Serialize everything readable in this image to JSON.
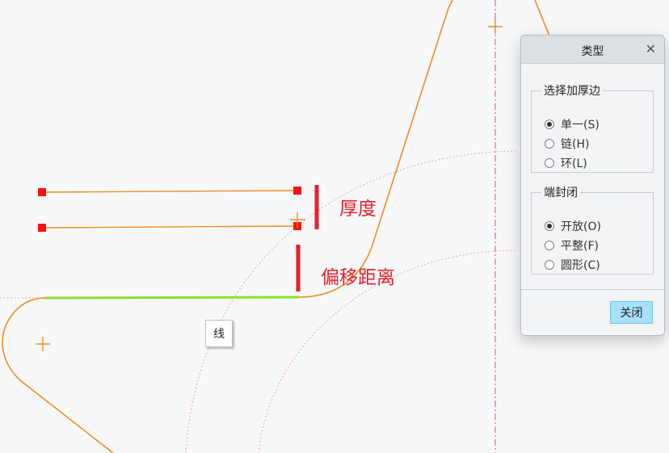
{
  "canvas": {
    "annotations": {
      "thickness": "厚度",
      "offset_distance": "偏移距离"
    },
    "tooltip": "线",
    "colors": {
      "curve": "#f28c1f",
      "selected_edge": "#8fe02a",
      "handle": "#ff1010",
      "annotation": "#e8202a",
      "dotted_guide": "#e98aa6",
      "centerline": "#ff5a9a"
    }
  },
  "dialog": {
    "title": "类型",
    "close_icon": "close-icon",
    "group_thicken_edge": {
      "label": "选择加厚边",
      "options": [
        {
          "label": "单一(S)",
          "checked": true
        },
        {
          "label": "链(H)",
          "checked": false
        },
        {
          "label": "环(L)",
          "checked": false
        }
      ]
    },
    "group_end_cap": {
      "label": "端封闭",
      "options": [
        {
          "label": "开放(O)",
          "checked": true
        },
        {
          "label": "平整(F)",
          "checked": false
        },
        {
          "label": "圆形(C)",
          "checked": false
        }
      ]
    },
    "close_button": "关闭"
  }
}
